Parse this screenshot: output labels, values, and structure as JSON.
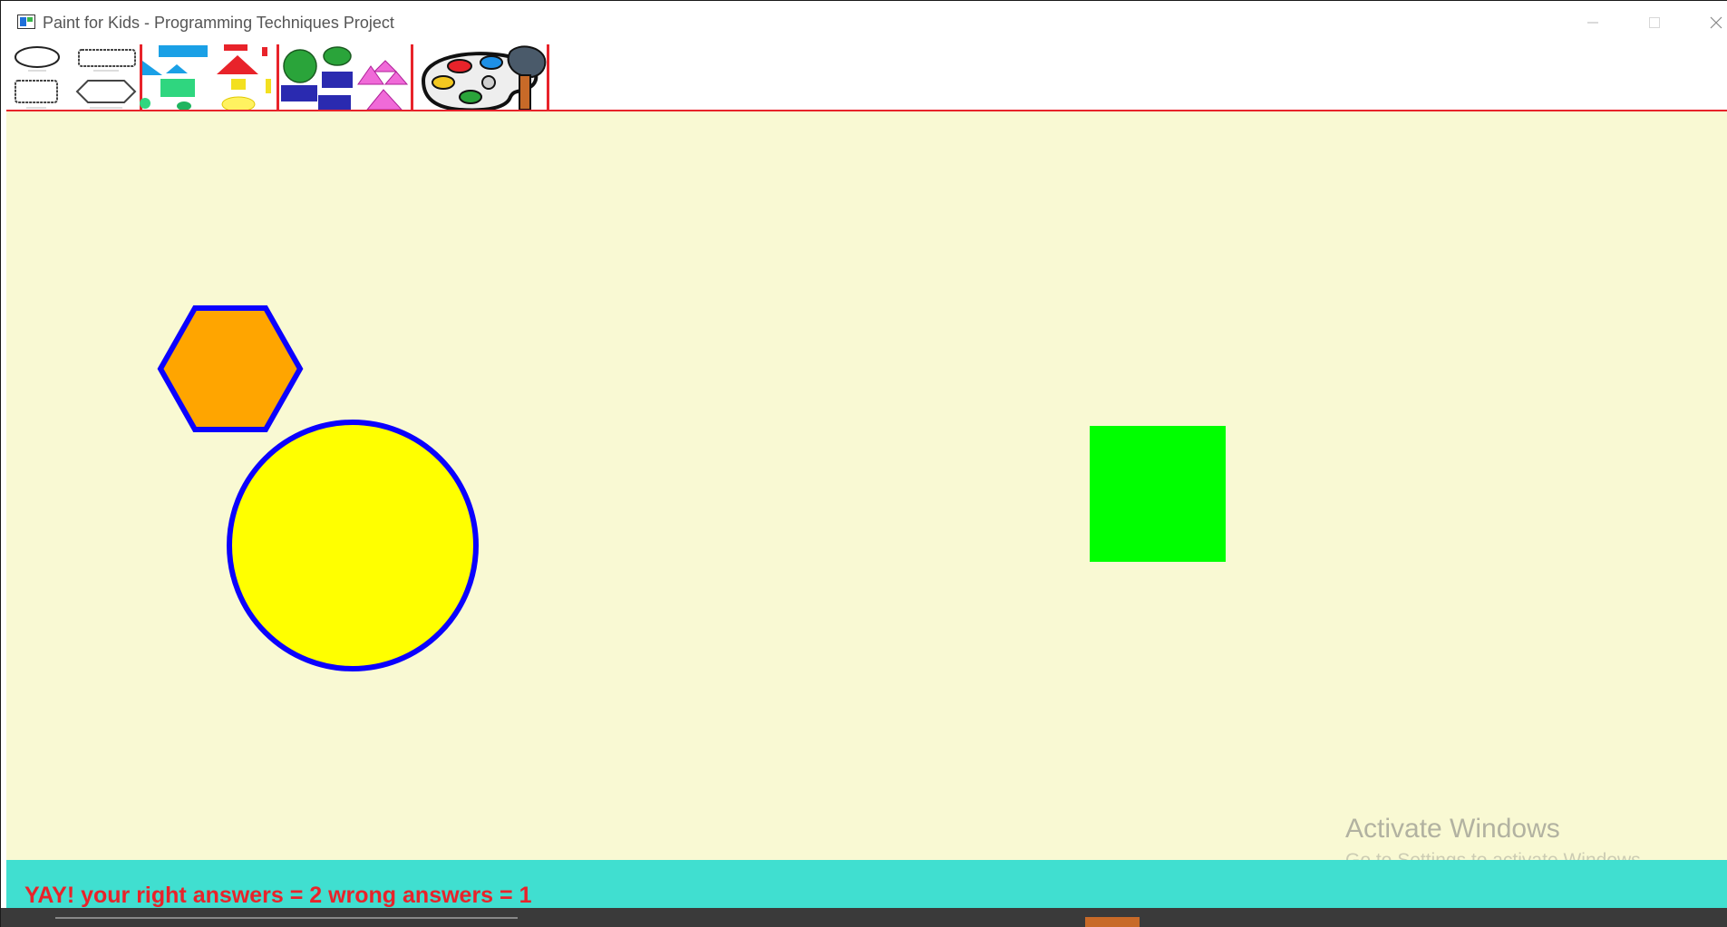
{
  "window": {
    "title": "Paint for Kids - Programming Techniques Project"
  },
  "toolbar": {
    "items": [
      {
        "name": "shape-types-tool",
        "icon": "shape-outlines-icon"
      },
      {
        "name": "pick-by-type-tool",
        "icon": "blue-shapes-icon"
      },
      {
        "name": "pick-by-color-tool",
        "icon": "colored-shapes-icon"
      },
      {
        "name": "pick-by-type-and-color-tool",
        "icon": "mixed-shapes-icon"
      },
      {
        "name": "palette-tool",
        "icon": "palette-brush-icon"
      }
    ]
  },
  "canvas": {
    "background": "#f9f9d3",
    "shapes": [
      {
        "type": "hexagon",
        "fill": "#ffa500",
        "border": "#0b00ff"
      },
      {
        "type": "circle",
        "fill": "#ffff00",
        "border": "#0b00ff"
      },
      {
        "type": "square",
        "fill": "#00ff00",
        "border": "#00ff00"
      }
    ]
  },
  "status": {
    "message": "YAY! your right answers = 2 wrong answers = 1",
    "color": "#e8232a",
    "background": "#40dfd0"
  },
  "watermark": {
    "title": "Activate Windows",
    "subtitle": "Go to Settings to activate Windows."
  },
  "colors": {
    "toolbar_separator": "#e8232a",
    "shape_border": "#0b00ff"
  }
}
